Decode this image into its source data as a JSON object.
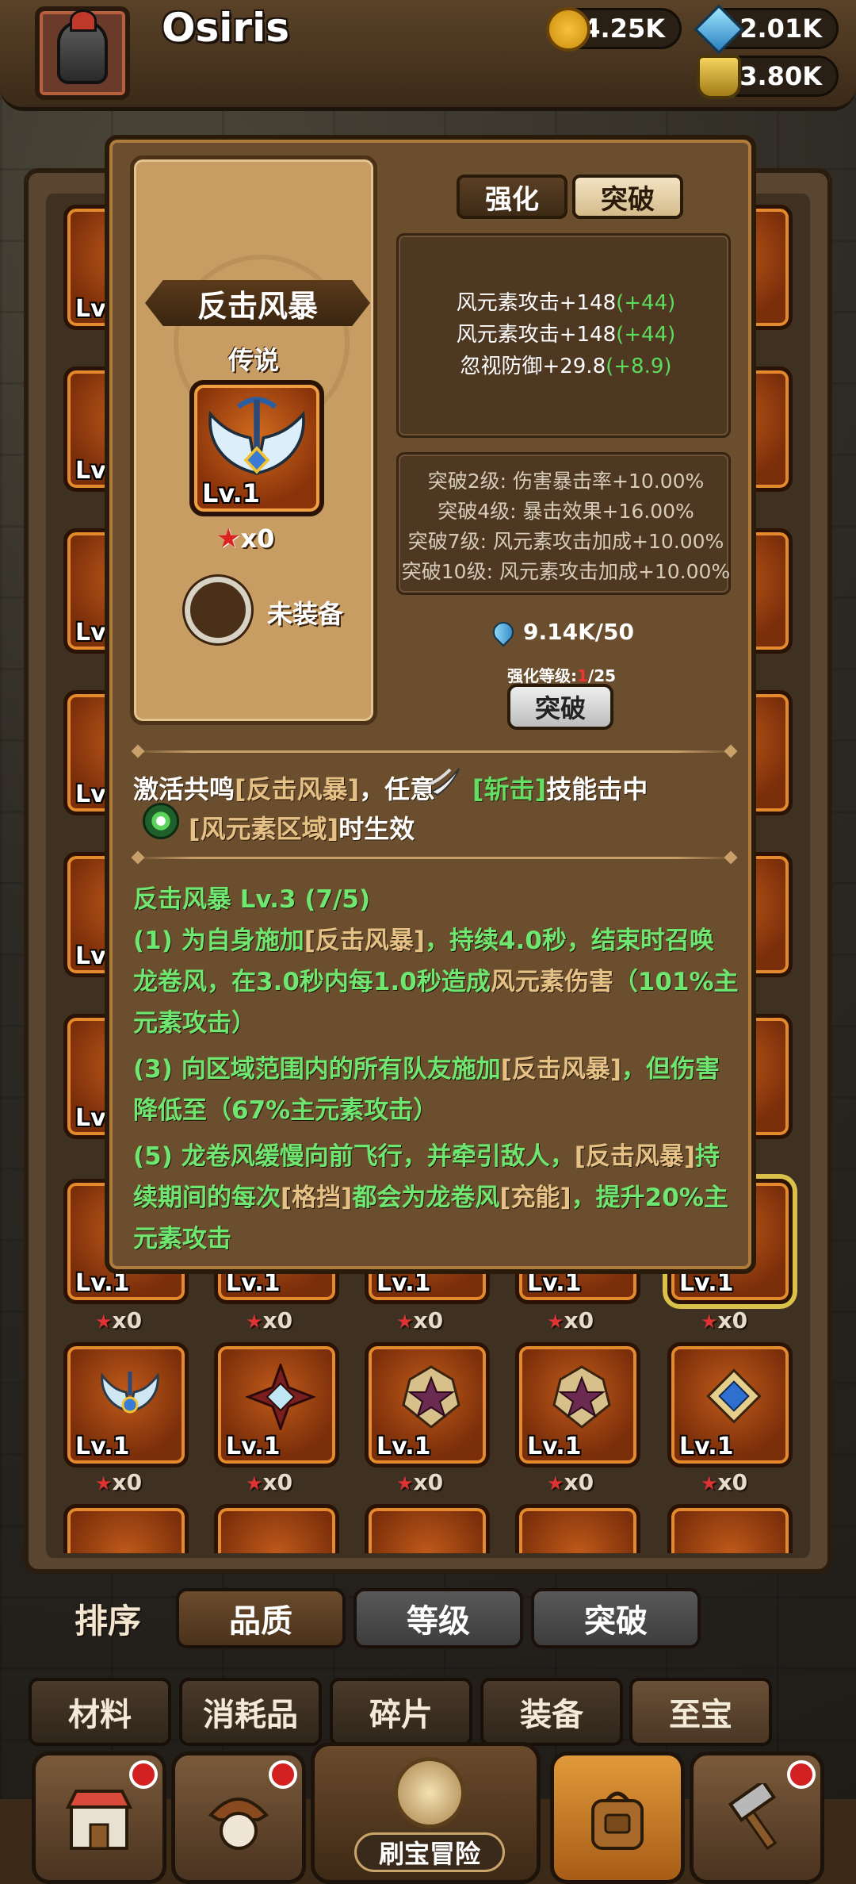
{
  "header": {
    "username": "Osiris",
    "gold": "104.25K",
    "gems": "2.01K",
    "potion": "53.80K"
  },
  "popup": {
    "tabs": [
      "强化",
      "突破"
    ],
    "item_name": "反击风暴",
    "rarity": "传说",
    "item_level": "Lv.1",
    "stars": "x0",
    "equip_status": "未装备",
    "stats": [
      {
        "text": "风元素攻击+148",
        "bonus": "(+44)"
      },
      {
        "text": "风元素攻击+148",
        "bonus": "(+44)"
      },
      {
        "text": "忽视防御+29.8",
        "bonus": "(+8.9)"
      }
    ],
    "breakthrough_bonuses": [
      "突破2级: 伤害暴击率+10.00%",
      "突破4级: 暴击效果+16.00%",
      "突破7级: 风元素攻击加成+10.00%",
      "突破10级: 风元素攻击加成+10.00%"
    ],
    "cost": "9.14K/50",
    "enhance_label": "强化等级:",
    "enhance_current": "1",
    "enhance_max": "/25",
    "break_button": "突破",
    "resonance": {
      "p1": "激活共鸣",
      "p2": "[反击风暴]",
      "p3": "，任意",
      "p4": "[斩击]",
      "p5": "技能击中",
      "p6": "[风元素区域]",
      "p7": "时生效"
    },
    "set_title": "反击风暴 Lv.3 (7/5)",
    "desc1": {
      "a": " (1) 为自身施加",
      "b": "[反击风暴]",
      "c": "，持续4.0秒，结束时召唤",
      "d": "龙卷风，在3.0秒内每1.0秒造成",
      "e": "风元素伤害",
      "f": "（101%主",
      "g": "元素攻击）"
    },
    "desc3": {
      "a": " (3) 向区域范围内的所有队友施加",
      "b": "[反击风暴]",
      "c": "，但伤害",
      "d": "降低至（67%主元素攻击）"
    },
    "desc5": {
      "a": " (5) 龙卷风缓慢向前飞行，并牵引敌人，",
      "b": "[反击风暴]",
      "c": "持",
      "d": "续期间的每次",
      "e": "[格挡]",
      "f": "都会为龙卷风",
      "g": "[充能]",
      "h": "，提升20%主",
      "i": "元素攻击"
    }
  },
  "inventory": {
    "row_lv": [
      "Lv.1",
      "Lv.1",
      "Lv.1",
      "Lv.1",
      "Lv.1"
    ],
    "row_counts": [
      "x0",
      "x0",
      "x0",
      "x0",
      "x0"
    ],
    "left_lv": [
      "Lv",
      "Lv",
      "Lv",
      "Lv",
      "Lv",
      "Lv"
    ],
    "row2_counts": [
      "x0",
      "x0",
      "x0",
      "x0",
      "x0"
    ]
  },
  "sort": {
    "label": "排序",
    "options": [
      "品质",
      "等级",
      "突破"
    ]
  },
  "categories": [
    "材料",
    "消耗品",
    "碎片",
    "装备",
    "至宝"
  ],
  "nav": {
    "adventure_label": "刷宝冒险"
  },
  "colors": {
    "bonus_green": "#5cdc5c",
    "desc_green": "#6fe66f",
    "highlight_yellow": "#e6c186",
    "accent_orange": "#e58a2c"
  }
}
